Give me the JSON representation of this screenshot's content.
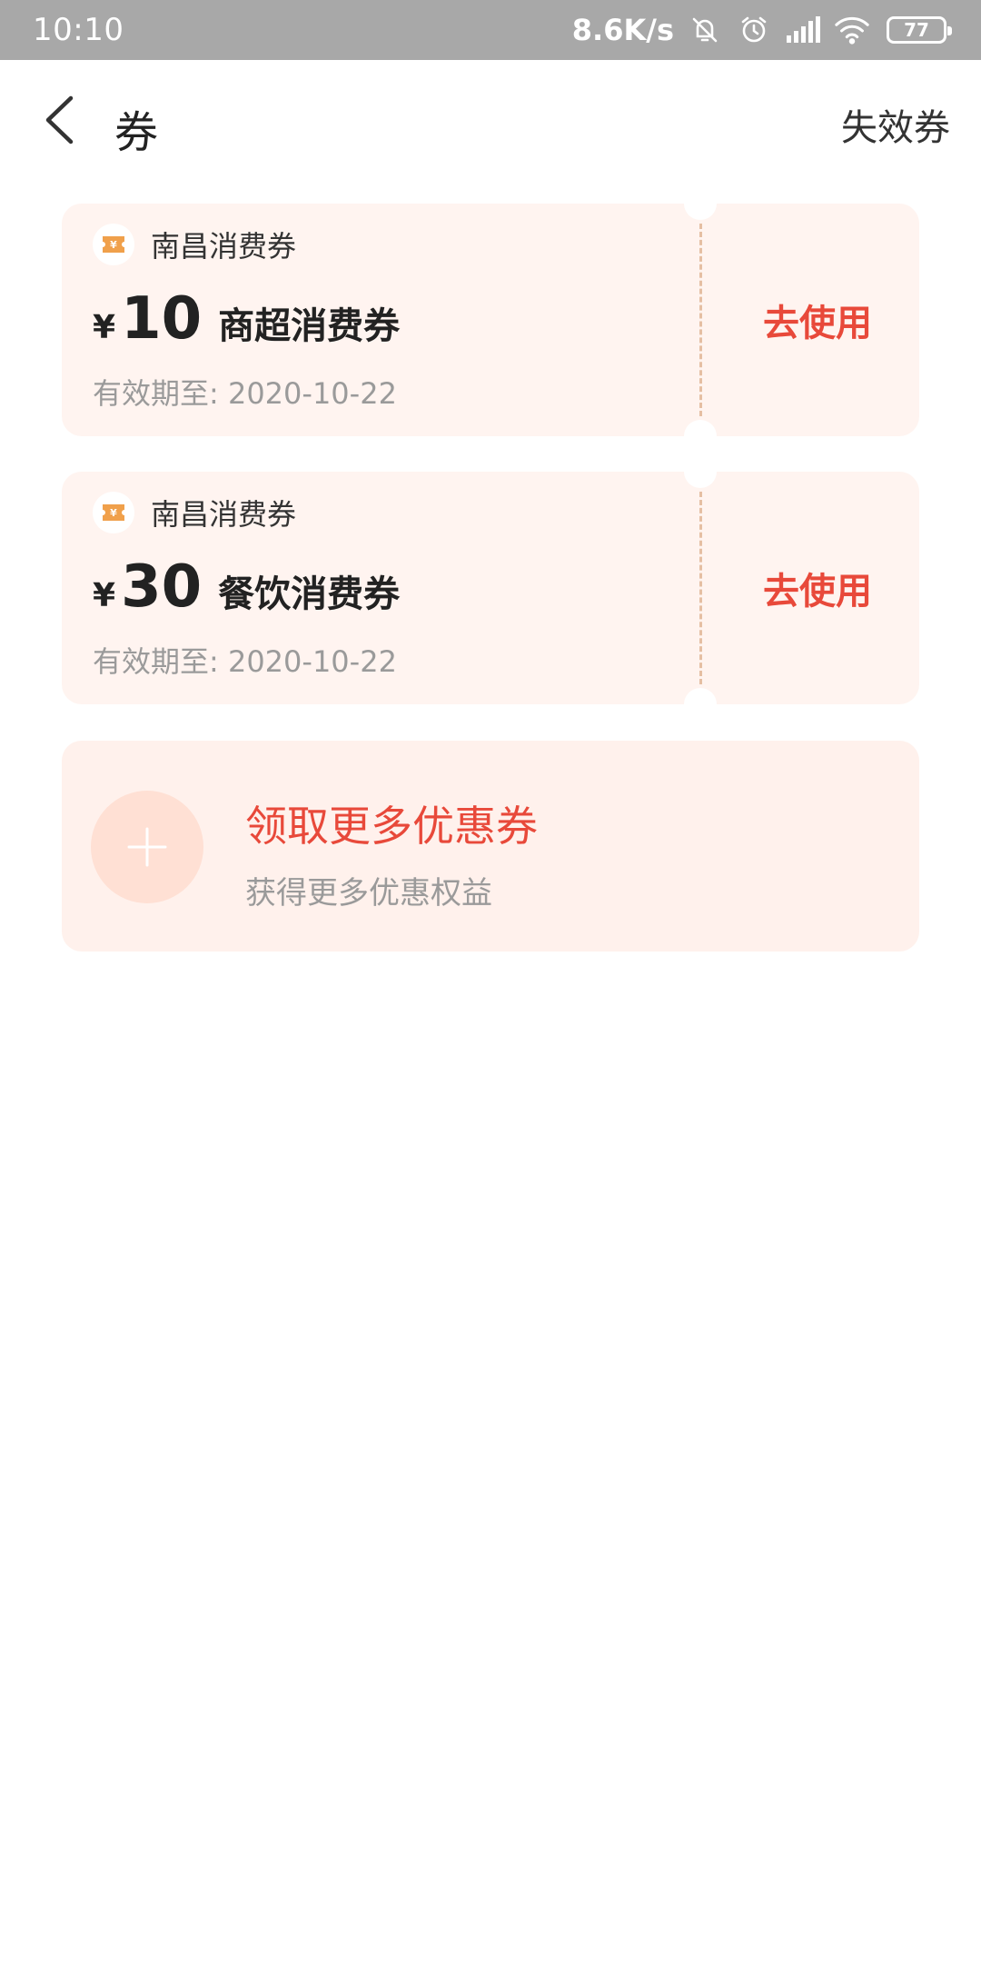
{
  "status_bar": {
    "time": "10:10",
    "net_speed": "8.6K/s",
    "battery": "77",
    "icons": [
      "bell-off-icon",
      "alarm-icon",
      "signal-icon",
      "wifi-icon",
      "battery-icon"
    ]
  },
  "header": {
    "title": "券",
    "expired_link": "失效券"
  },
  "coupons": [
    {
      "brand": "南昌消费券",
      "currency": "¥",
      "amount": "10",
      "name": "商超消费券",
      "validity": "有效期至: 2020-10-22",
      "action": "去使用"
    },
    {
      "brand": "南昌消费券",
      "currency": "¥",
      "amount": "30",
      "name": "餐饮消费券",
      "validity": "有效期至: 2020-10-22",
      "action": "去使用"
    }
  ],
  "more": {
    "title": "领取更多优惠券",
    "subtitle": "获得更多优惠权益"
  },
  "colors": {
    "accent": "#e8493a",
    "card_bg": "#fff4f0",
    "status_bg": "#a8a8a8"
  }
}
